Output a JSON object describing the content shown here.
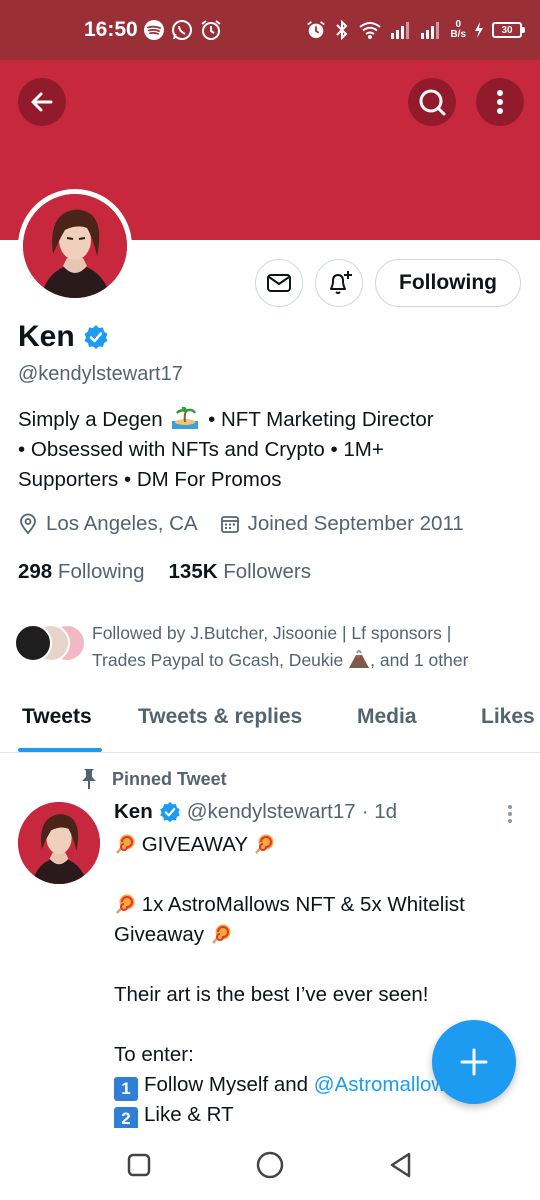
{
  "status_bar": {
    "time": "16:50",
    "net_speed_value": "0",
    "net_speed_unit": "B/s",
    "battery": "30"
  },
  "colors": {
    "banner": "#c8283e",
    "status_bar": "#9a2f38",
    "accent": "#1d9bf0",
    "secondary_text": "#536471"
  },
  "header": {
    "back_icon": "arrow-left-icon",
    "search_icon": "search-icon",
    "more_icon": "more-vertical-icon"
  },
  "profile": {
    "name": "Ken",
    "handle": "@kendylstewart17",
    "verified": true,
    "bio_line1": "Simply a Degen",
    "bio_line1_rest": "• NFT Marketing Director",
    "bio_line2": "• Obsessed with NFTs and Crypto • 1M+",
    "bio_line3": "Supporters • DM For Promos",
    "location": "Los Angeles, CA",
    "joined": "Joined September 2011",
    "following_count": "298",
    "following_label": "Following",
    "followers_count": "135K",
    "followers_label": "Followers",
    "followed_by_line1": "Followed by J.Butcher, Jisoonie | Lf sponsors |",
    "followed_by_line2a": "Trades Paypal to Gcash, Deukie",
    "followed_by_line2b": ", and 1 other"
  },
  "actions": {
    "following_button": "Following",
    "message_icon": "mail-icon",
    "notify_icon": "bell-plus-icon"
  },
  "tabs": [
    {
      "label": "Tweets",
      "active": true
    },
    {
      "label": "Tweets & replies",
      "active": false
    },
    {
      "label": "Media",
      "active": false
    },
    {
      "label": "Likes",
      "active": false
    }
  ],
  "tweet": {
    "pinned_label": "Pinned Tweet",
    "name": "Ken",
    "handle": "@kendylstewart17",
    "time": "· 1d",
    "line1": "GIVEAWAY",
    "line2": "1x AstroMallows NFT & 5x Whitelist",
    "line3": "Giveaway",
    "line4": "Their art is the best I’ve ever seen!",
    "line5": "To enter:",
    "step1_num": "1",
    "step1_text": "Follow Myself and ",
    "step1_mention": "@Astromallows",
    "step2_num": "2",
    "step2_text": "Like & RT"
  },
  "fab": {
    "icon": "plus-icon"
  },
  "nav": {
    "recents_icon": "square-icon",
    "home_icon": "circle-icon",
    "back_icon": "triangle-back-icon"
  }
}
